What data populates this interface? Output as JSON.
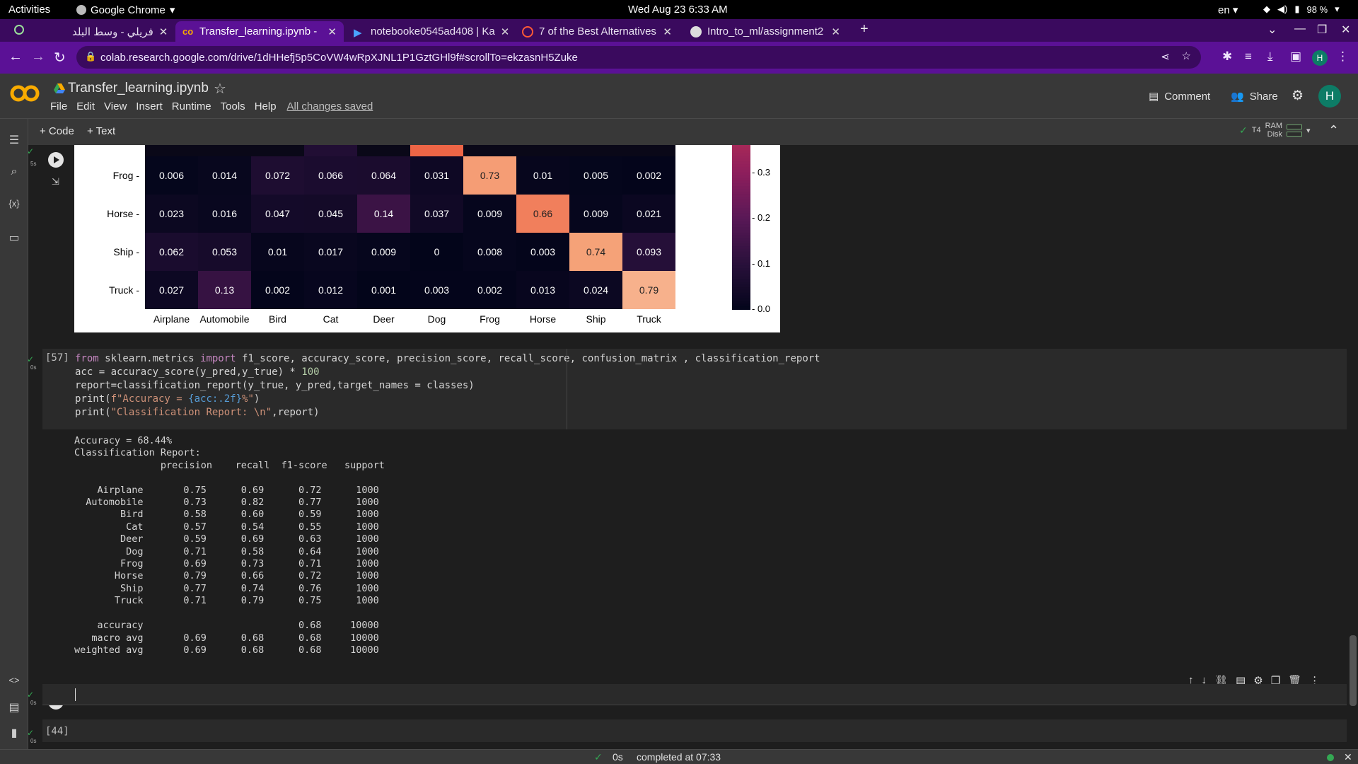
{
  "topbar": {
    "activities": "Activities",
    "app": "Google Chrome",
    "clock": "Wed Aug 23  6:33 AM",
    "lang": "en",
    "battery": "98 %"
  },
  "tabs": [
    {
      "title": "فريلي - وسط البلد",
      "active": false
    },
    {
      "title": "Transfer_learning.ipynb -",
      "active": true
    },
    {
      "title": "notebooke0545ad408 | Ka",
      "active": false
    },
    {
      "title": "7 of the Best Alternatives",
      "active": false
    },
    {
      "title": "Intro_to_ml/assignment2",
      "active": false
    }
  ],
  "address": {
    "url": "colab.research.google.com/drive/1dHHefj5p5CoVW4wRpXJNL1P1GztGHl9f#scrollTo=ekzasnH5Zuke"
  },
  "colab": {
    "title": "Transfer_learning.ipynb",
    "menu": [
      "File",
      "Edit",
      "View",
      "Insert",
      "Runtime",
      "Tools",
      "Help"
    ],
    "saved": "All changes saved",
    "comment": "Comment",
    "share": "Share",
    "avatar": "H",
    "add_code": "+ Code",
    "add_text": "+ Text",
    "gpu": "T4",
    "ram": "RAM",
    "disk": "Disk"
  },
  "heatmap": {
    "rows": [
      "Frog",
      "Horse",
      "Ship",
      "Truck"
    ],
    "columns": [
      "Airplane",
      "Automobile",
      "Bird",
      "Cat",
      "Deer",
      "Dog",
      "Frog",
      "Horse",
      "Ship",
      "Truck"
    ],
    "values": [
      [
        "0.006",
        "0.014",
        "0.072",
        "0.066",
        "0.064",
        "0.031",
        "0.73",
        "0.01",
        "0.005",
        "0.002"
      ],
      [
        "0.023",
        "0.016",
        "0.047",
        "0.045",
        "0.14",
        "0.037",
        "0.009",
        "0.66",
        "0.009",
        "0.021"
      ],
      [
        "0.062",
        "0.053",
        "0.01",
        "0.017",
        "0.009",
        "0",
        "0.008",
        "0.003",
        "0.74",
        "0.093"
      ],
      [
        "0.027",
        "0.13",
        "0.002",
        "0.012",
        "0.001",
        "0.003",
        "0.002",
        "0.013",
        "0.024",
        "0.79"
      ]
    ],
    "colorbar_ticks": [
      "0.3",
      "0.2",
      "0.1",
      "0.0"
    ]
  },
  "code_cell": {
    "exec_count": "[57]",
    "exec_time": "0s"
  },
  "output": {
    "text": "Accuracy = 68.44%\nClassification Report: \n               precision    recall  f1-score   support\n\n    Airplane       0.75      0.69      0.72      1000\n  Automobile       0.73      0.82      0.77      1000\n        Bird       0.58      0.60      0.59      1000\n         Cat       0.57      0.54      0.55      1000\n        Deer       0.59      0.69      0.63      1000\n         Dog       0.71      0.58      0.64      1000\n        Frog       0.69      0.73      0.71      1000\n       Horse       0.79      0.66      0.72      1000\n        Ship       0.77      0.74      0.76      1000\n       Truck       0.71      0.79      0.75      1000\n\n    accuracy                           0.68     10000\n   macro avg       0.69      0.68      0.68     10000\nweighted avg       0.69      0.68      0.68     10000"
  },
  "empty_cell": {
    "exec_time": "0s"
  },
  "cell44": {
    "exec_count": "[44]",
    "exec_time": "0s"
  },
  "first_cell": {
    "exec_time": "5s"
  },
  "statusbar": {
    "time": "0s",
    "completed": "completed at 07:33"
  }
}
